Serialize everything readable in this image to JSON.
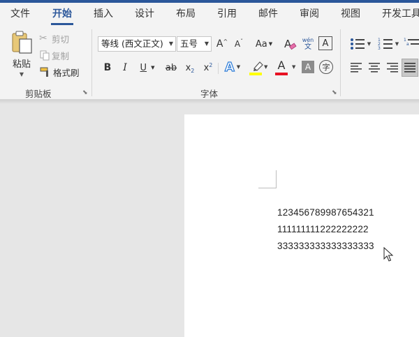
{
  "tabs": [
    "文件",
    "开始",
    "插入",
    "设计",
    "布局",
    "引用",
    "邮件",
    "审阅",
    "视图",
    "开发工具"
  ],
  "active_tab": "开始",
  "clipboard": {
    "paste_label": "粘贴",
    "cut_label": "剪切",
    "copy_label": "复制",
    "format_painter_label": "格式刷",
    "group_label": "剪贴板"
  },
  "font": {
    "font_name": "等线 (西文正文)",
    "font_size": "五号",
    "grow_label": "A",
    "shrink_label": "A",
    "case_label": "Aa",
    "phonetic_top": "wén",
    "phonetic_bottom": "文",
    "bold_label": "B",
    "italic_label": "I",
    "underline_label": "U",
    "strike_label": "ab",
    "subscript_label": "x",
    "subscript_mark": "2",
    "superscript_label": "x",
    "superscript_mark": "2",
    "effects_label": "A",
    "highlight_label": "ab",
    "color_label": "A",
    "shading_label": "A",
    "enclose_label": "字",
    "group_label": "字体",
    "highlight_color": "#ffff00",
    "font_color": "#e81123"
  },
  "document": {
    "lines": [
      "12345678998765432​1",
      "111111111222222222",
      "333333333333333333"
    ]
  },
  "colors": {
    "accent": "#2b579a"
  }
}
